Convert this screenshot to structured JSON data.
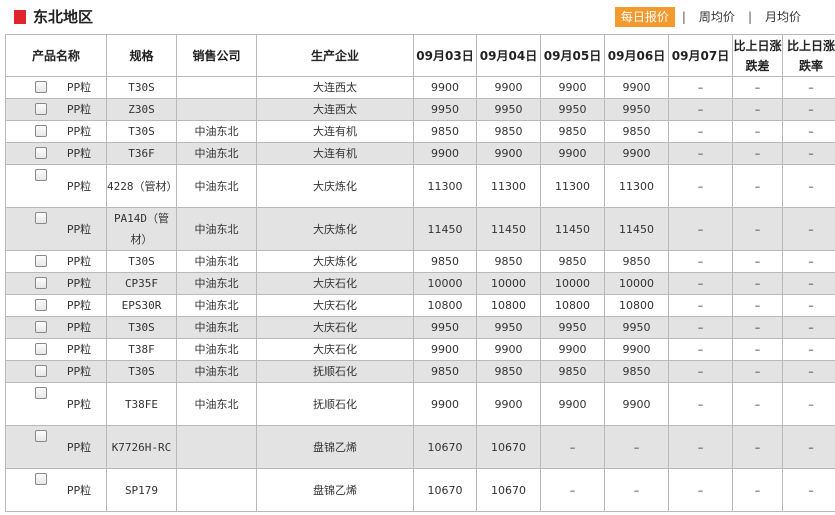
{
  "region_title": "东北地区",
  "tabs": [
    {
      "label": "每日报价",
      "active": true
    },
    {
      "label": "周均价",
      "active": false
    },
    {
      "label": "月均价",
      "active": false
    }
  ],
  "tab_separator": "|",
  "headers": [
    "产品名称",
    "规格",
    "销售公司",
    "生产企业",
    "09月03日",
    "09月04日",
    "09月05日",
    "09月06日",
    "09月07日",
    "比上日涨跌差",
    "比上日涨跌率"
  ],
  "rows": [
    {
      "product": "PP粒",
      "spec": "T30S",
      "company": "",
      "producer": "大连西太",
      "d0903": "9900",
      "d0904": "9900",
      "d0905": "9900",
      "d0906": "9900",
      "d0907": "–",
      "diff": "–",
      "rate": "–",
      "alt": false
    },
    {
      "product": "PP粒",
      "spec": "Z30S",
      "company": "",
      "producer": "大连西太",
      "d0903": "9950",
      "d0904": "9950",
      "d0905": "9950",
      "d0906": "9950",
      "d0907": "–",
      "diff": "–",
      "rate": "–",
      "alt": true
    },
    {
      "product": "PP粒",
      "spec": "T30S",
      "company": "中油东北",
      "producer": "大连有机",
      "d0903": "9850",
      "d0904": "9850",
      "d0905": "9850",
      "d0906": "9850",
      "d0907": "–",
      "diff": "–",
      "rate": "–",
      "alt": false
    },
    {
      "product": "PP粒",
      "spec": "T36F",
      "company": "中油东北",
      "producer": "大连有机",
      "d0903": "9900",
      "d0904": "9900",
      "d0905": "9900",
      "d0906": "9900",
      "d0907": "–",
      "diff": "–",
      "rate": "–",
      "alt": true
    },
    {
      "product": "PP粒",
      "spec": "4228（管材）",
      "company": "中油东北",
      "producer": "大庆炼化",
      "d0903": "11300",
      "d0904": "11300",
      "d0905": "11300",
      "d0906": "11300",
      "d0907": "–",
      "diff": "–",
      "rate": "–",
      "alt": false,
      "tall": true
    },
    {
      "product": "PP粒",
      "spec": "PA14D（管材）",
      "company": "中油东北",
      "producer": "大庆炼化",
      "d0903": "11450",
      "d0904": "11450",
      "d0905": "11450",
      "d0906": "11450",
      "d0907": "–",
      "diff": "–",
      "rate": "–",
      "alt": true,
      "tall": true
    },
    {
      "product": "PP粒",
      "spec": "T30S",
      "company": "中油东北",
      "producer": "大庆炼化",
      "d0903": "9850",
      "d0904": "9850",
      "d0905": "9850",
      "d0906": "9850",
      "d0907": "–",
      "diff": "–",
      "rate": "–",
      "alt": false
    },
    {
      "product": "PP粒",
      "spec": "CP35F",
      "company": "中油东北",
      "producer": "大庆石化",
      "d0903": "10000",
      "d0904": "10000",
      "d0905": "10000",
      "d0906": "10000",
      "d0907": "–",
      "diff": "–",
      "rate": "–",
      "alt": true
    },
    {
      "product": "PP粒",
      "spec": "EPS30R",
      "company": "中油东北",
      "producer": "大庆石化",
      "d0903": "10800",
      "d0904": "10800",
      "d0905": "10800",
      "d0906": "10800",
      "d0907": "–",
      "diff": "–",
      "rate": "–",
      "alt": false
    },
    {
      "product": "PP粒",
      "spec": "T30S",
      "company": "中油东北",
      "producer": "大庆石化",
      "d0903": "9950",
      "d0904": "9950",
      "d0905": "9950",
      "d0906": "9950",
      "d0907": "–",
      "diff": "–",
      "rate": "–",
      "alt": true
    },
    {
      "product": "PP粒",
      "spec": "T38F",
      "company": "中油东北",
      "producer": "大庆石化",
      "d0903": "9900",
      "d0904": "9900",
      "d0905": "9900",
      "d0906": "9900",
      "d0907": "–",
      "diff": "–",
      "rate": "–",
      "alt": false
    },
    {
      "product": "PP粒",
      "spec": "T30S",
      "company": "中油东北",
      "producer": "抚顺石化",
      "d0903": "9850",
      "d0904": "9850",
      "d0905": "9850",
      "d0906": "9850",
      "d0907": "–",
      "diff": "–",
      "rate": "–",
      "alt": true
    },
    {
      "product": "PP粒",
      "spec": "T38FE",
      "company": "中油东北",
      "producer": "抚顺石化",
      "d0903": "9900",
      "d0904": "9900",
      "d0905": "9900",
      "d0906": "9900",
      "d0907": "–",
      "diff": "–",
      "rate": "–",
      "alt": false,
      "tall": true
    },
    {
      "product": "PP粒",
      "spec": "K7726H-RC",
      "company": "",
      "producer": "盘锦乙烯",
      "d0903": "10670",
      "d0904": "10670",
      "d0905": "–",
      "d0906": "–",
      "d0907": "–",
      "diff": "–",
      "rate": "–",
      "alt": true,
      "tall": true
    },
    {
      "product": "PP粒",
      "spec": "SP179",
      "company": "",
      "producer": "盘锦乙烯",
      "d0903": "10670",
      "d0904": "10670",
      "d0905": "–",
      "d0906": "–",
      "d0907": "–",
      "diff": "–",
      "rate": "–",
      "alt": false,
      "tall": true
    }
  ]
}
